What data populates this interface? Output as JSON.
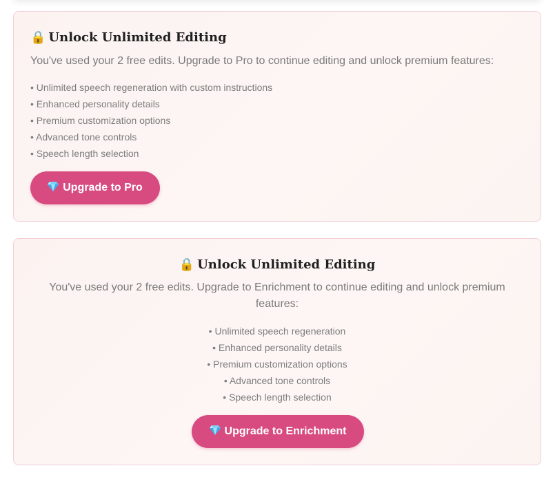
{
  "cards": [
    {
      "title": "Unlock Unlimited Editing",
      "title_icon": "lock-icon",
      "description": "You've used your 2 free edits. Upgrade to Pro to continue editing and unlock premium features:",
      "features": [
        "Unlimited speech regeneration with custom instructions",
        "Enhanced personality details",
        "Premium customization options",
        "Advanced tone controls",
        "Speech length selection"
      ],
      "button": {
        "label": "Upgrade to Pro",
        "icon": "gem-icon"
      }
    },
    {
      "title": "Unlock Unlimited Editing",
      "title_icon": "lock-icon",
      "description": "You've used your 2 free edits. Upgrade to Enrichment to continue editing and unlock premium features:",
      "features": [
        "Unlimited speech regeneration",
        "Enhanced personality details",
        "Premium customization options",
        "Advanced tone controls",
        "Speech length selection"
      ],
      "button": {
        "label": "Upgrade to Enrichment",
        "icon": "gem-icon"
      }
    }
  ],
  "colors": {
    "accent": "#d74b80",
    "card_border": "#f2cfd9",
    "card_background": "#fcf4f2",
    "muted_text": "#7a7a7a"
  }
}
